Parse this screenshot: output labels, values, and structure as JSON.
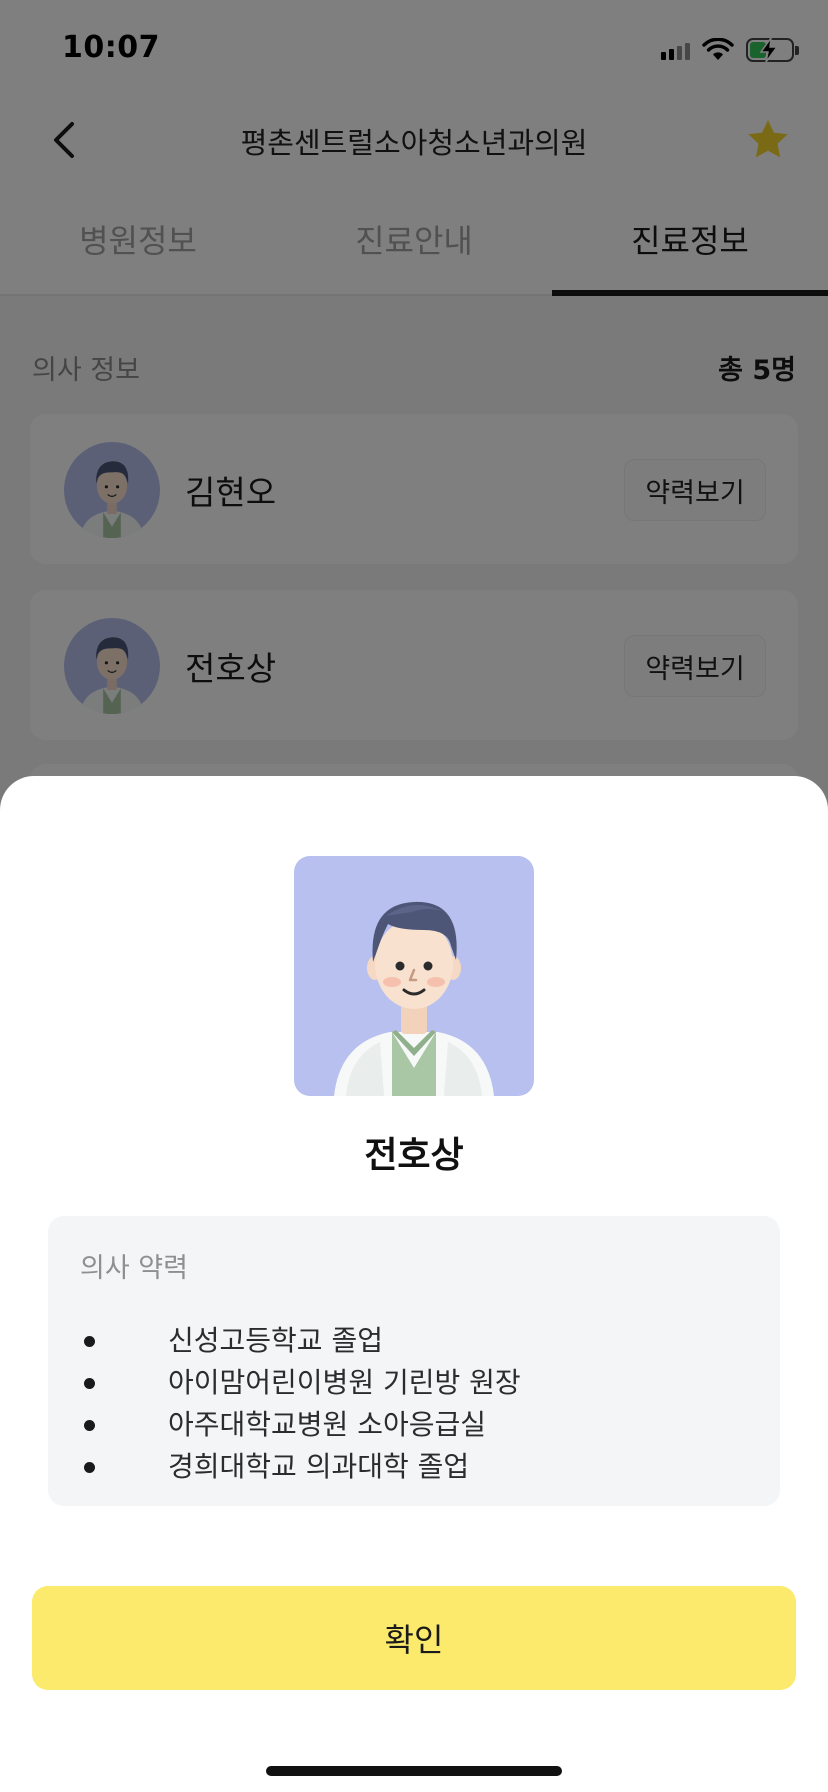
{
  "status_bar": {
    "time": "10:07",
    "battery_fraction": 0.4,
    "battery_color": "#34c759"
  },
  "nav": {
    "title": "평촌센트럴소아청소년과의원",
    "back_icon": "chevron-left-icon",
    "favorite_icon": "star-icon",
    "star_color": "#f5d32a"
  },
  "tabs": [
    {
      "label": "병원정보"
    },
    {
      "label": "진료안내"
    },
    {
      "label": "진료정보"
    }
  ],
  "active_tab": "진료정보",
  "doctor_section": {
    "title": "의사 정보",
    "count_label": "총 5명",
    "doctors": [
      {
        "name": "김현오",
        "career_button": "약력보기"
      },
      {
        "name": "전호상",
        "career_button": "약력보기"
      }
    ]
  },
  "sheet": {
    "doctor_name": "전호상",
    "career_title": "의사 약력",
    "career_items": [
      "신성고등학교 졸업",
      "아이맘어린이병원 기린방 원장",
      "아주대학교병원 소아응급실",
      "경희대학교 의과대학 졸업"
    ],
    "confirm_label": "확인",
    "confirm_color": "#fbea6c",
    "avatar_bg": "#b7c0ef"
  }
}
